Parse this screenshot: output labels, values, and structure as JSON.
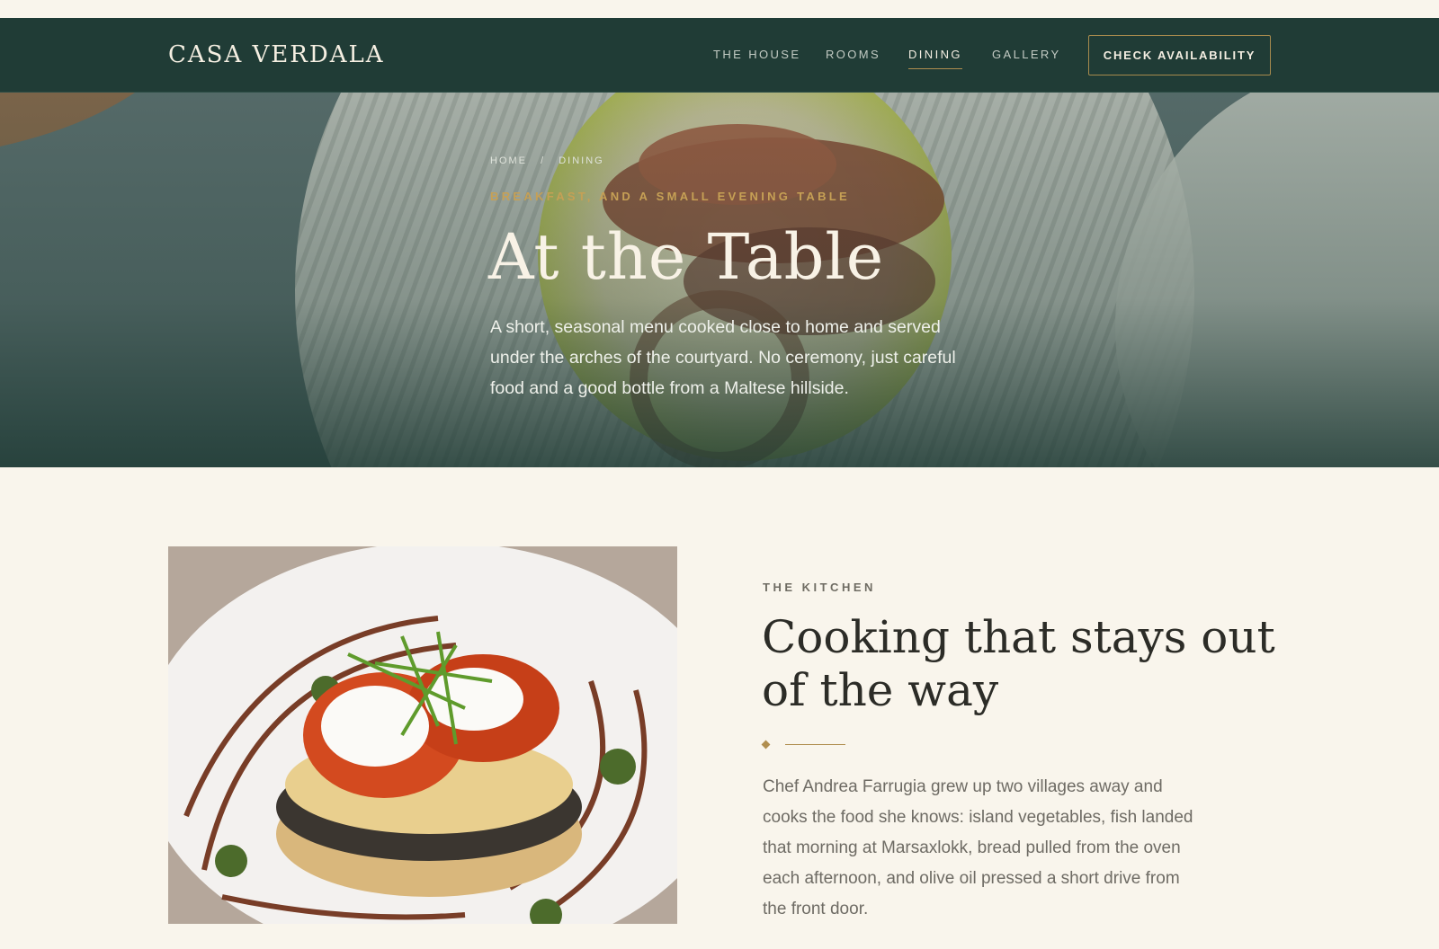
{
  "nav": {
    "logo": "CASA VERDALA",
    "links": [
      "THE HOUSE",
      "ROOMS",
      "DINING",
      "GALLERY"
    ],
    "active": "DINING",
    "cta": "CHECK AVAILABILITY"
  },
  "hero": {
    "breadcrumb": [
      "HOME",
      "/",
      "DINING"
    ],
    "eyebrow": "BREAKFAST, AND A SMALL EVENING TABLE",
    "title": "At the Table",
    "text": "A short, seasonal menu cooked close to home and served under the arches of the courtyard. No ceremony, just careful food and a good bottle from a Maltese hillside.",
    "image": "grilled-octopus-on-white-plate"
  },
  "kitchen": {
    "eyebrow": "THE KITCHEN",
    "title": "Cooking that stays out of the way",
    "text": "Chef Andrea Farrugia grew up two villages away and cooks the food she knows: island vegetables, fish landed that morning at Marsaxlokk, bread pulled from the oven each afternoon, and olive oil pressed a short drive from the front door.",
    "image": "poached-egg-stack-with-balsamic"
  },
  "colors": {
    "nav_bg": "#203c36",
    "accent": "#b08e4f",
    "page_bg": "#f9f5ec"
  }
}
